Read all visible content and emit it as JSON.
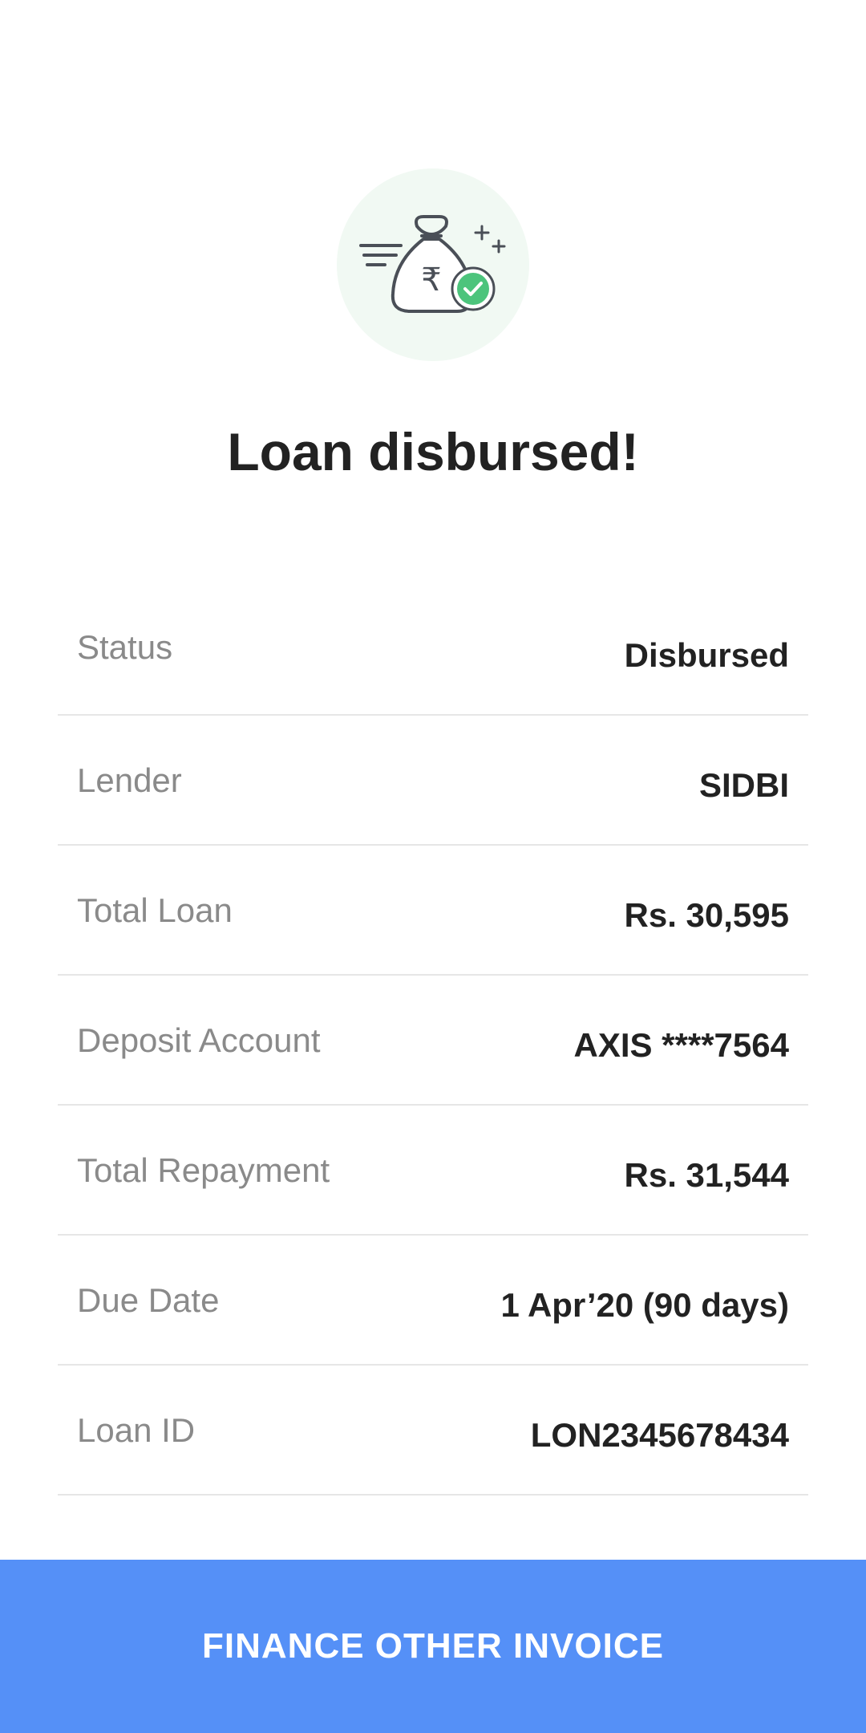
{
  "header": {
    "icon": "money-bag-with-check-icon",
    "title": "Loan disbursed!"
  },
  "details": [
    {
      "label": "Status",
      "value": "Disbursed"
    },
    {
      "label": "Lender",
      "value": "SIDBI"
    },
    {
      "label": "Total Loan",
      "value": "Rs. 30,595"
    },
    {
      "label": "Deposit Account",
      "value": "AXIS ****7564"
    },
    {
      "label": "Total Repayment",
      "value": "Rs. 31,544"
    },
    {
      "label": "Due Date",
      "value": "1 Apr’20 (90 days)"
    },
    {
      "label": "Loan ID",
      "value": "LON2345678434"
    }
  ],
  "footer": {
    "cta_label": "FINANCE OTHER INVOICE"
  },
  "colors": {
    "accent": "#5590f7",
    "success": "#4cc47c",
    "icon_bg": "#f1f9f3",
    "label": "#8a8a8a",
    "value": "#222222"
  }
}
